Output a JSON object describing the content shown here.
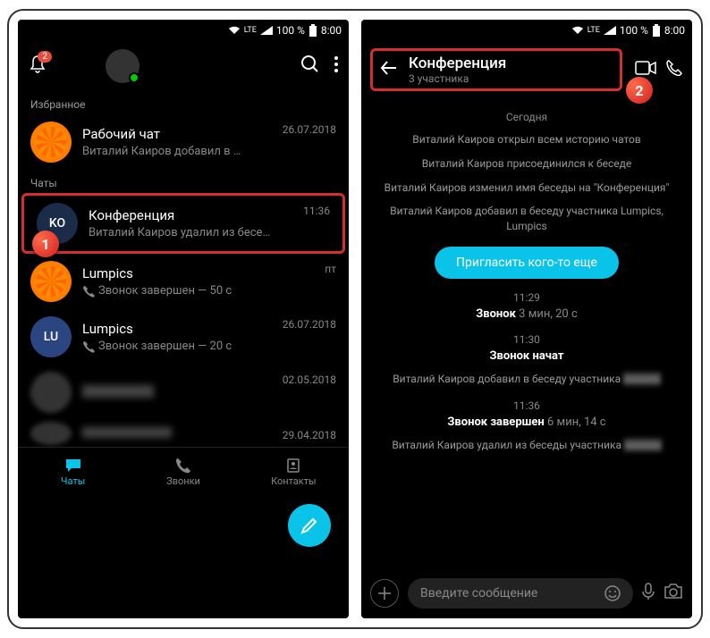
{
  "status": {
    "net": "LTE",
    "batt": "100 %",
    "time": "8:00"
  },
  "left": {
    "badge": "2",
    "sect1": "Избранное",
    "sect2": "Чаты",
    "chats": [
      {
        "name": "Рабочий чат",
        "sub": "Виталий Каиров добавил в …",
        "time": "26.07.2018"
      },
      {
        "name": "Конференция",
        "sub": "Виталий Каиров удалил из бесе…",
        "time": "11:36",
        "av": "KO"
      },
      {
        "name": "Lumpics",
        "sub": "Звонок завершен — 50 с",
        "time": "пт"
      },
      {
        "name": "Lumpics",
        "sub": "Звонок завершен — 20 с",
        "time": "26.07.2018",
        "av": "LU"
      },
      {
        "name": "",
        "sub": "",
        "time": "02.05.2018"
      },
      {
        "name": "",
        "sub": "",
        "time": "29.04.2018"
      }
    ],
    "nav": {
      "chats": "Чаты",
      "calls": "Звонки",
      "contacts": "Контакты"
    }
  },
  "right": {
    "title": "Конференция",
    "sub": "3 участника",
    "day": "Сегодня",
    "sys": [
      "Виталий Каиров открыл всем историю чатов",
      "Виталий Каиров присоединился к беседе",
      "Виталий Каиров изменил имя беседы на \"Конференция\"",
      "Виталий Каиров добавил в беседу участника Lumpics, Lumpics"
    ],
    "invite": "Пригласить кого-то еще",
    "events": [
      {
        "t": "11:29",
        "l": "Звонок",
        "d": "3 мин, 20 с"
      },
      {
        "t": "11:30",
        "l": "Звонок начат",
        "d": ""
      }
    ],
    "sys2": "Виталий Каиров добавил в беседу участника",
    "ev3": {
      "t": "11:36",
      "l": "Звонок завершен",
      "d": "6 мин, 14 с"
    },
    "sys3": "Виталий Каиров удалил из беседы участника",
    "placeholder": "Введите сообщение"
  }
}
